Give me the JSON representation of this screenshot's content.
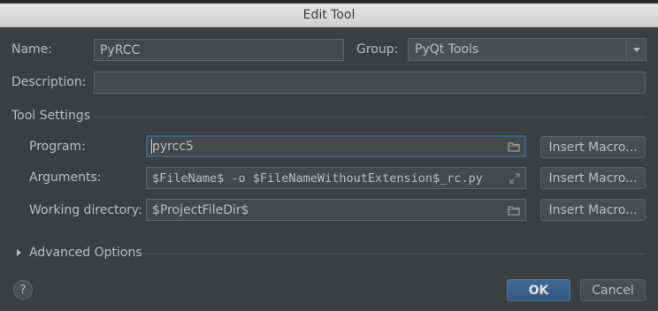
{
  "window": {
    "title": "Edit Tool"
  },
  "form": {
    "name_label": "Name:",
    "name_value": "PyRCC",
    "group_label": "Group:",
    "group_value": "PyQt Tools",
    "description_label": "Description:",
    "description_value": ""
  },
  "tool_settings": {
    "section_label": "Tool Settings",
    "program_label": "Program:",
    "program_value": "pyrcc5",
    "arguments_label": "Arguments:",
    "arguments_value": "$FileName$ -o $FileNameWithoutExtension$_rc.py",
    "working_dir_label": "Working directory:",
    "working_dir_value": "$ProjectFileDir$",
    "insert_macro_label": "Insert Macro..."
  },
  "advanced": {
    "label": "Advanced Options"
  },
  "footer": {
    "help_label": "?",
    "ok_label": "OK",
    "cancel_label": "Cancel"
  },
  "colors": {
    "background": "#3c3f41",
    "field_bg": "#45494a",
    "accent": "#365880"
  },
  "icons": {
    "folder": "folder-icon",
    "expand": "expand-icon",
    "dropdown": "chevron-down-icon",
    "advanced": "chevron-right-icon",
    "help": "help-icon"
  }
}
